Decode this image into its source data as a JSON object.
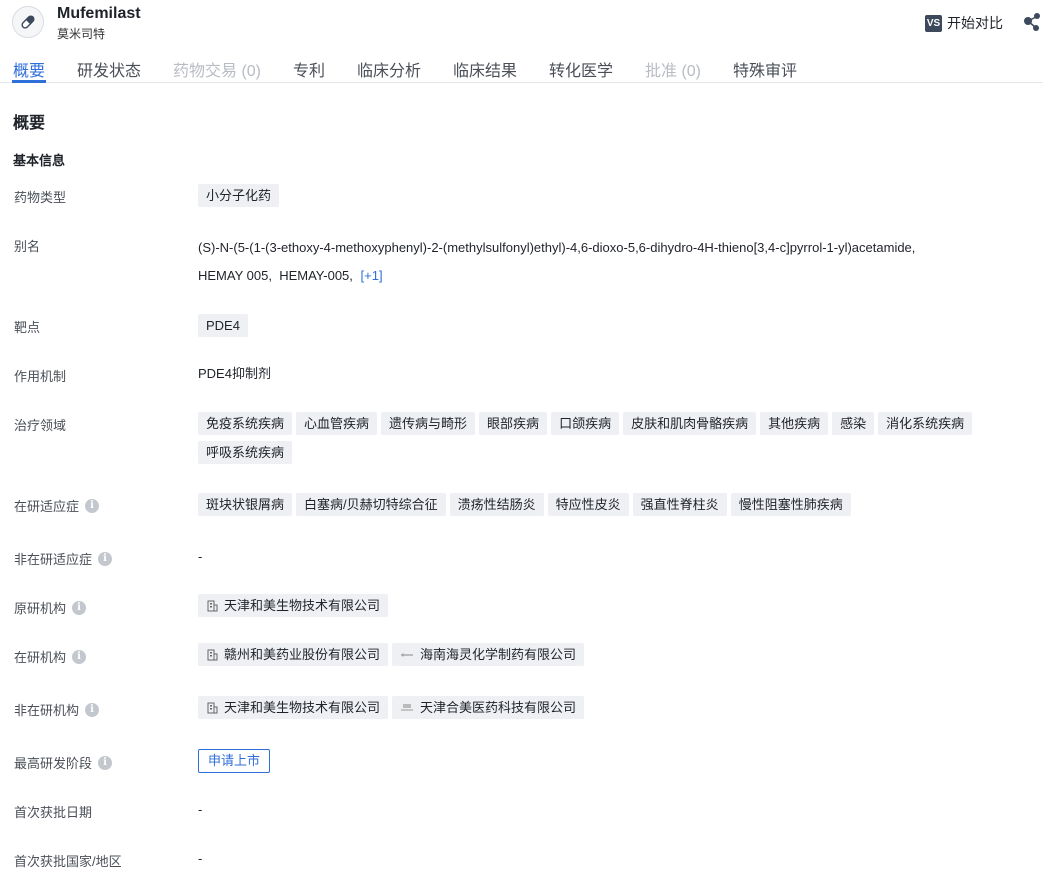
{
  "header": {
    "drug_name": "Mufemilast",
    "drug_cn_name": "莫米司特",
    "compare_vs": "VS",
    "compare_label": "开始对比"
  },
  "tabs": [
    {
      "label": "概要",
      "state": "active"
    },
    {
      "label": "研发状态",
      "state": "normal"
    },
    {
      "label": "药物交易 (0)",
      "state": "disabled"
    },
    {
      "label": "专利",
      "state": "normal"
    },
    {
      "label": "临床分析",
      "state": "normal"
    },
    {
      "label": "临床结果",
      "state": "normal"
    },
    {
      "label": "转化医学",
      "state": "normal"
    },
    {
      "label": "批准 (0)",
      "state": "disabled"
    },
    {
      "label": "特殊审评",
      "state": "normal"
    }
  ],
  "overview": {
    "section_title": "概要",
    "sub_title": "基本信息",
    "drug_type": {
      "label": "药物类型",
      "value": "小分子化药"
    },
    "aliases": {
      "label": "别名",
      "items": [
        "(S)-N-(5-(1-(3-ethoxy-4-methoxyphenyl)-2-(methylsulfonyl)ethyl)-4,6-dioxo-5,6-dihydro-4H-thieno[3,4-c]pyrrol-1-yl)acetamide,",
        "HEMAY 005,",
        "HEMAY-005,"
      ],
      "more": "[+1]"
    },
    "target": {
      "label": "靶点",
      "value": "PDE4"
    },
    "mechanism": {
      "label": "作用机制",
      "value": "PDE4抑制剂"
    },
    "therapeutic_areas": {
      "label": "治疗领域",
      "items": [
        "免疫系统疾病",
        "心血管疾病",
        "遗传病与畸形",
        "眼部疾病",
        "口颌疾病",
        "皮肤和肌肉骨骼疾病",
        "其他疾病",
        "感染",
        "消化系统疾病",
        "呼吸系统疾病"
      ]
    },
    "active_indications": {
      "label": "在研适应症",
      "items": [
        "斑块状银屑病",
        "白塞病/贝赫切特综合征",
        "溃疡性结肠炎",
        "特应性皮炎",
        "强直性脊柱炎",
        "慢性阻塞性肺疾病"
      ]
    },
    "inactive_indications": {
      "label": "非在研适应症",
      "value": "-"
    },
    "originator": {
      "label": "原研机构",
      "items": [
        {
          "name": "天津和美生物技术有限公司",
          "icon": "building-icon"
        }
      ]
    },
    "active_orgs": {
      "label": "在研机构",
      "items": [
        {
          "name": "赣州和美药业股份有限公司",
          "icon": "building-icon"
        },
        {
          "name": "海南海灵化学制药有限公司",
          "icon": "company-logo"
        }
      ]
    },
    "inactive_orgs": {
      "label": "非在研机构",
      "items": [
        {
          "name": "天津和美生物技术有限公司",
          "icon": "building-icon"
        },
        {
          "name": "天津合美医药科技有限公司",
          "icon": "company-logo"
        }
      ]
    },
    "highest_phase": {
      "label": "最高研发阶段",
      "value": "申请上市"
    },
    "first_approval_date": {
      "label": "首次获批日期",
      "value": "-"
    },
    "first_approval_country": {
      "label": "首次获批国家/地区",
      "value": "-"
    }
  },
  "colors": {
    "accent": "#2f6fda",
    "tag_bg": "#eef0f3",
    "disabled": "#b8bcc4"
  }
}
